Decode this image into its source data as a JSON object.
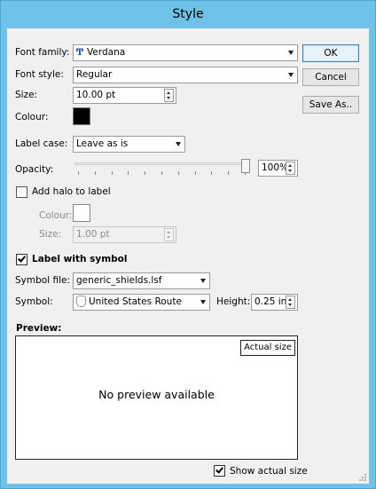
{
  "window": {
    "title": "Style"
  },
  "buttons": {
    "ok": "OK",
    "cancel": "Cancel",
    "save_as": "Save As.."
  },
  "font_family": {
    "label": "Font family:",
    "value": "Verdana",
    "icon": "truetype-font-icon"
  },
  "font_style": {
    "label": "Font style:",
    "value": "Regular"
  },
  "size": {
    "label": "Size:",
    "value": "10.00 pt"
  },
  "colour": {
    "label": "Colour:",
    "value": "#000000"
  },
  "label_case": {
    "label": "Label case:",
    "value": "Leave as is"
  },
  "opacity": {
    "label": "Opacity:",
    "value": "100%",
    "level": 1.0
  },
  "halo": {
    "label": "Add halo to label",
    "checked": false,
    "colour_label": "Colour:",
    "colour_value": "#ffffff",
    "size_label": "Size:",
    "size_value": "1.00 pt"
  },
  "symbol": {
    "label_with_symbol": "Label with symbol",
    "checked": true,
    "file_label": "Symbol file:",
    "file_value": "generic_shields.lsf",
    "symbol_label": "Symbol:",
    "symbol_value": "United States Route",
    "height_label": "Height:",
    "height_value": "0.25 in"
  },
  "preview": {
    "title": "Preview:",
    "actual_size_tag": "Actual size",
    "message": "No preview available",
    "show_actual_size": "Show actual size",
    "show_actual_checked": true
  }
}
